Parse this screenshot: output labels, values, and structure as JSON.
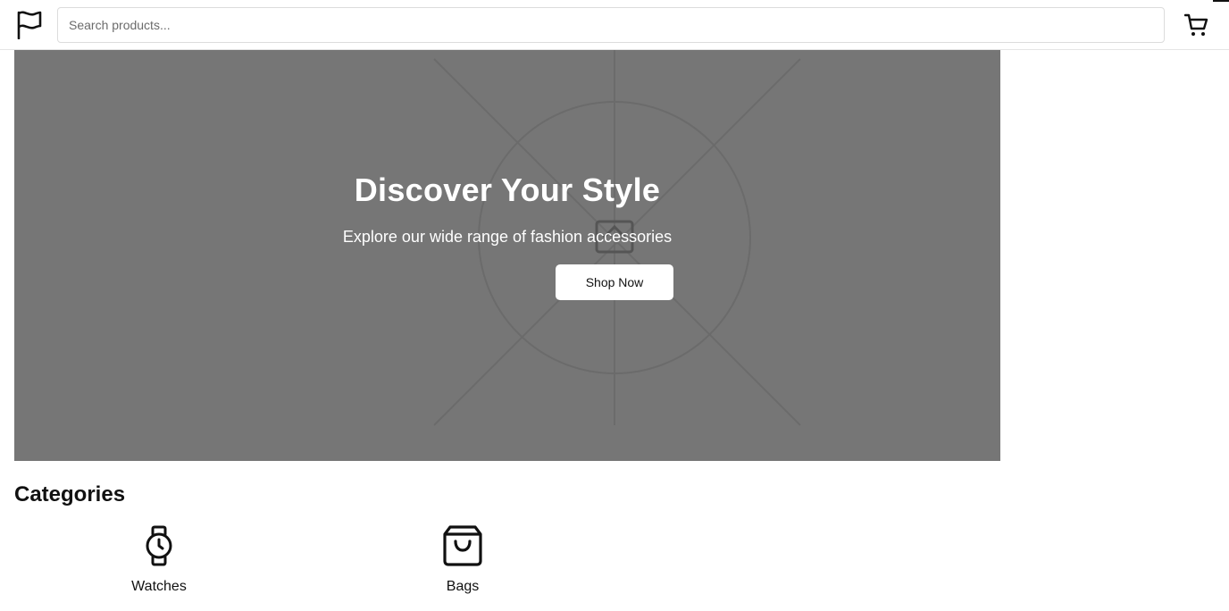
{
  "header": {
    "logo_icon": "flag-icon",
    "search": {
      "placeholder": "Search products...",
      "value": ""
    },
    "cart_icon": "cart-icon"
  },
  "hero": {
    "title": "Discover Your Style",
    "subtitle": "Explore our wide range of fashion accessories",
    "button_label": "Shop Now",
    "background_color": "#767676",
    "image_placeholder_icon": "image-placeholder-icon"
  },
  "categories": {
    "title": "Categories",
    "items": [
      {
        "label": "Watches",
        "icon": "watch-icon"
      },
      {
        "label": "Bags",
        "icon": "shopping-bag-icon"
      }
    ]
  }
}
